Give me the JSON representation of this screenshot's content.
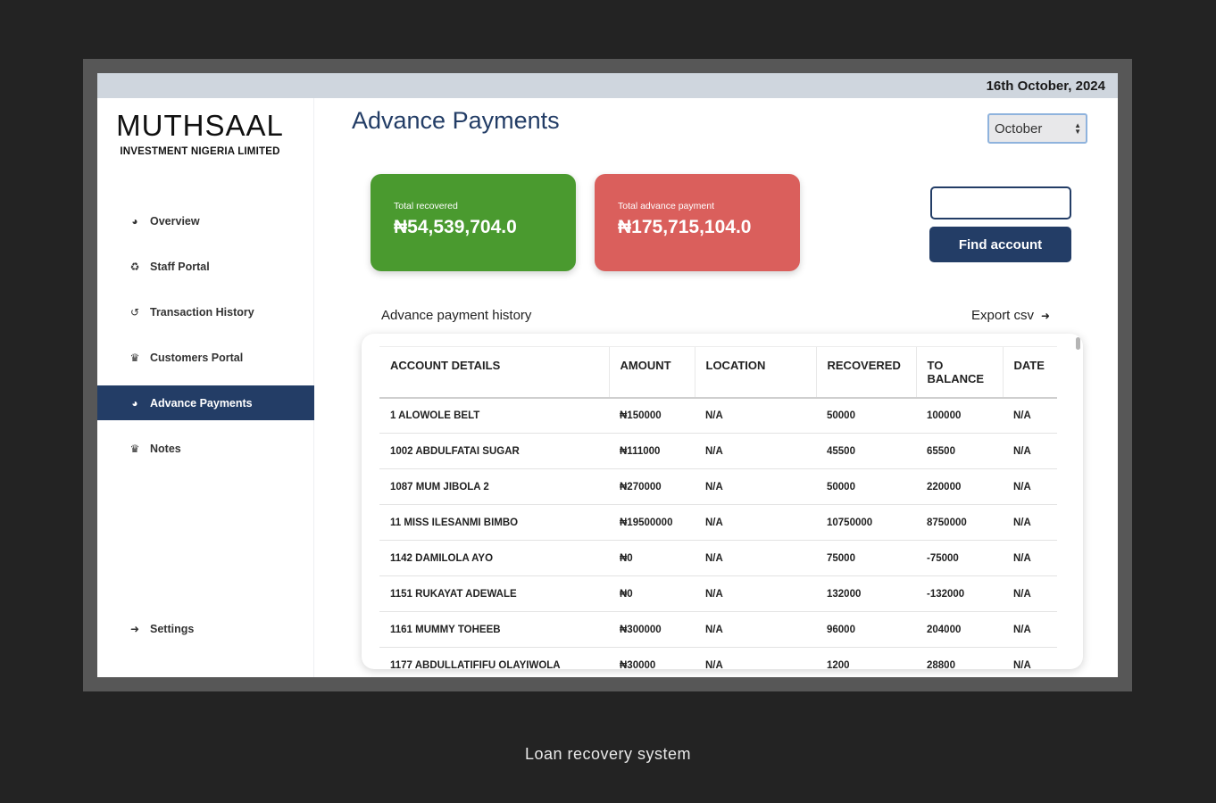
{
  "topbar": {
    "date": "16th October, 2024"
  },
  "brand": {
    "name": "MUTHSAAL",
    "subtitle": "INVESTMENT NIGERIA LIMITED"
  },
  "sidebar": {
    "items": [
      {
        "label": "Overview",
        "icon": "dashboard-icon"
      },
      {
        "label": "Staff Portal",
        "icon": "recycle-icon"
      },
      {
        "label": "Transaction History",
        "icon": "history-icon"
      },
      {
        "label": "Customers Portal",
        "icon": "trophy-icon"
      },
      {
        "label": "Advance Payments",
        "icon": "dashboard-icon",
        "active": true
      },
      {
        "label": "Notes",
        "icon": "trophy-icon"
      }
    ],
    "settings": {
      "label": "Settings",
      "icon": "sign-out-icon"
    }
  },
  "main": {
    "title": "Advance Payments",
    "month_select": {
      "value": "October"
    },
    "cards": {
      "recovered": {
        "label": "Total recovered",
        "value": "₦54,539,704.0",
        "color": "#4a9a2f"
      },
      "advance": {
        "label": "Total advance payment",
        "value": "₦175,715,104.0",
        "color": "#da5f5c"
      }
    },
    "search": {
      "value": "",
      "button_label": "Find account"
    },
    "history": {
      "title": "Advance payment history",
      "export_label": "Export csv"
    },
    "table": {
      "headers": [
        "ACCOUNT DETAILS",
        "AMOUNT",
        "LOCATION",
        "RECOVERED",
        "TO BALANCE",
        "DATE"
      ],
      "rows": [
        [
          "1 ALOWOLE BELT",
          "₦150000",
          "N/A",
          "50000",
          "100000",
          "N/A"
        ],
        [
          "1002 ABDULFATAI SUGAR",
          "₦111000",
          "N/A",
          "45500",
          "65500",
          "N/A"
        ],
        [
          "1087 MUM JIBOLA 2",
          "₦270000",
          "N/A",
          "50000",
          "220000",
          "N/A"
        ],
        [
          "11 MISS ILESANMI BIMBO",
          "₦19500000",
          "N/A",
          "10750000",
          "8750000",
          "N/A"
        ],
        [
          "1142 DAMILOLA AYO",
          "₦0",
          "N/A",
          "75000",
          "-75000",
          "N/A"
        ],
        [
          "1151 RUKAYAT ADEWALE",
          "₦0",
          "N/A",
          "132000",
          "-132000",
          "N/A"
        ],
        [
          "1161 MUMMY TOHEEB",
          "₦300000",
          "N/A",
          "96000",
          "204000",
          "N/A"
        ],
        [
          "1177 ABDULLATIFIFU OLAYIWOLA",
          "₦30000",
          "N/A",
          "1200",
          "28800",
          "N/A"
        ]
      ]
    }
  },
  "caption": "Loan recovery system",
  "colors": {
    "accent": "#233d66",
    "topbar": "#cfd6de",
    "background": "#232323"
  }
}
